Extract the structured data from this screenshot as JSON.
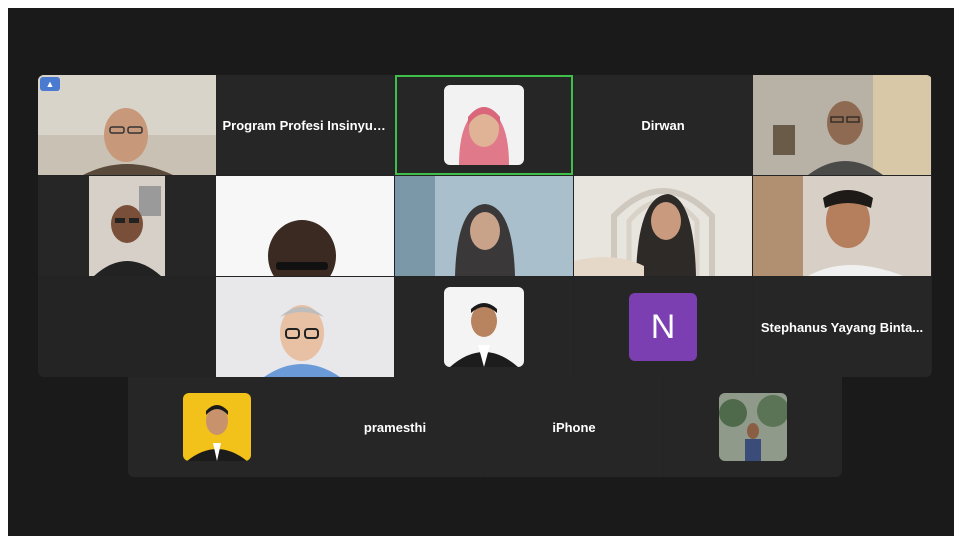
{
  "participants": {
    "program": "Program Profesi Insinyur...",
    "dirwan": "Dirwan",
    "stephanus": "Stephanus Yayang Binta...",
    "n_initial": "N",
    "pramesthi": "pramesthi",
    "iphone": "iPhone"
  },
  "colors": {
    "active_speaker": "#3fbf4a",
    "avatar_purple": "#7c3fb2"
  }
}
